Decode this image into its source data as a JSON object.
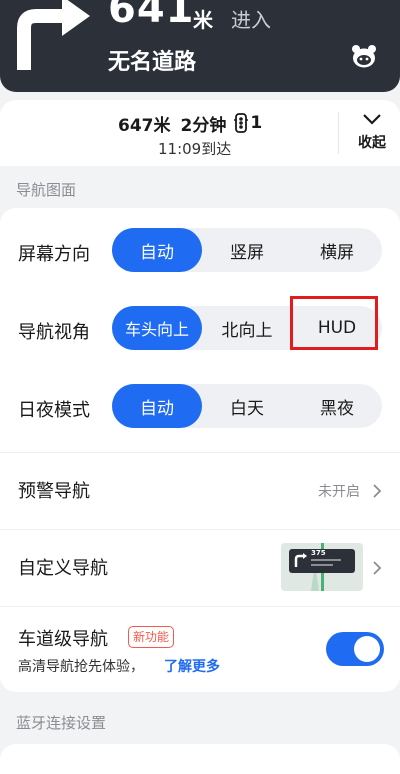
{
  "banner": {
    "distance": "641",
    "unit": "米",
    "action": "进入",
    "road": "无名道路"
  },
  "trip": {
    "summary_distance": "647米",
    "summary_time": "2分钟",
    "lights": "1",
    "eta": "11:09到达",
    "collapse_label": "收起"
  },
  "sections": {
    "nav_display": "导航图面",
    "bluetooth": "蓝牙连接设置"
  },
  "settings": {
    "screen_orientation": {
      "label": "屏幕方向",
      "options": [
        "自动",
        "竖屏",
        "横屏"
      ],
      "selected": "自动"
    },
    "nav_view": {
      "label": "导航视角",
      "options": [
        "车头向上",
        "北向上",
        "HUD"
      ],
      "selected": "车头向上"
    },
    "day_night": {
      "label": "日夜模式",
      "options": [
        "自动",
        "白天",
        "黑夜"
      ],
      "selected": "自动"
    },
    "warning_nav": {
      "label": "预警导航",
      "value": "未开启"
    },
    "custom_nav": {
      "label": "自定义导航",
      "thumb_distance": "375"
    },
    "lane_nav": {
      "label": "车道级导航",
      "badge": "新功能",
      "desc": "高清导航抢先体验，",
      "link": "了解更多",
      "enabled": true
    }
  },
  "colors": {
    "accent": "#1f6cf2",
    "banner_bg": "#2b3039",
    "highlight": "#e31b1b",
    "badge": "#f25a4b"
  }
}
